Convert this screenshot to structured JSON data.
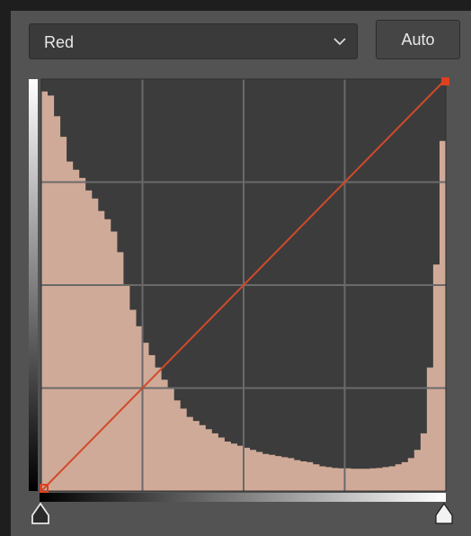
{
  "channel": {
    "selected": "Red"
  },
  "auto_button": {
    "label": "Auto"
  },
  "colors": {
    "histogram_fill": "#d0aa98",
    "graph_background": "#3c3c3c",
    "curve_line": "#d04a2a",
    "control_point": "#e0401e",
    "panel_background": "#535353"
  },
  "curve": {
    "points": [
      [
        0,
        0
      ],
      [
        255,
        255
      ]
    ]
  },
  "histogram": {
    "bins": 64,
    "levels": [
      0.97,
      0.96,
      0.91,
      0.86,
      0.8,
      0.78,
      0.76,
      0.73,
      0.71,
      0.68,
      0.66,
      0.63,
      0.58,
      0.5,
      0.44,
      0.4,
      0.36,
      0.33,
      0.3,
      0.27,
      0.25,
      0.22,
      0.2,
      0.18,
      0.17,
      0.16,
      0.15,
      0.14,
      0.13,
      0.12,
      0.115,
      0.11,
      0.105,
      0.1,
      0.095,
      0.09,
      0.088,
      0.085,
      0.082,
      0.08,
      0.075,
      0.072,
      0.07,
      0.065,
      0.06,
      0.058,
      0.056,
      0.055,
      0.055,
      0.054,
      0.054,
      0.054,
      0.055,
      0.056,
      0.058,
      0.06,
      0.065,
      0.07,
      0.08,
      0.1,
      0.14,
      0.3,
      0.55,
      0.85
    ]
  },
  "icons": {
    "dropdown": "chevron-down-icon",
    "black_point": "black-point-slider-icon",
    "white_point": "white-point-slider-icon"
  }
}
